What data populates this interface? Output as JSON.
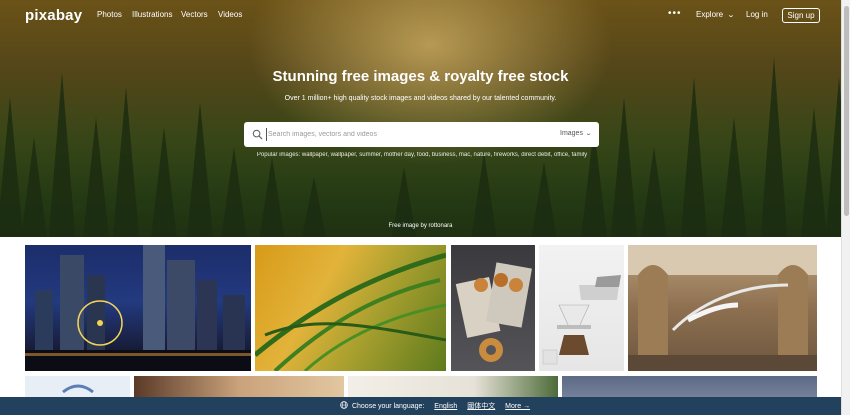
{
  "brand": {
    "logo_text": "pixabay"
  },
  "nav": {
    "links": [
      {
        "label": "Photos"
      },
      {
        "label": "Illustrations"
      },
      {
        "label": "Vectors"
      },
      {
        "label": "Videos"
      }
    ],
    "more_label": "•••",
    "explore_label": "Explore",
    "login_label": "Log in",
    "signup_label": "Sign up"
  },
  "hero": {
    "title": "Stunning free images & royalty free stock",
    "subtitle": "Over 1 million+ high quality stock images and videos shared by our talented community.",
    "credit": "Free image by rottonara"
  },
  "search": {
    "placeholder": "Search images, vectors and videos",
    "type_label": "Images"
  },
  "popular": {
    "text": "Popular images: wallpaper, wallpaper, summer, mother day, food, business, mac, nature, fireworks, direct debit, office, family"
  },
  "gallery": {
    "row1": [
      "city skyline at night with ferris wheel",
      "green grass blades",
      "pastry on table",
      "coffee pour over",
      "museum skeleton hall"
    ],
    "row2": [
      "light blue image",
      "building interior",
      "table scene",
      "cloudy sky"
    ]
  },
  "language_bar": {
    "prompt": "Choose your language:",
    "options": [
      "English",
      "國体中文"
    ],
    "more_label": "More →"
  },
  "colors": {
    "language_bar_bg": "#22415c",
    "hero_accent": "#e2b33a"
  }
}
